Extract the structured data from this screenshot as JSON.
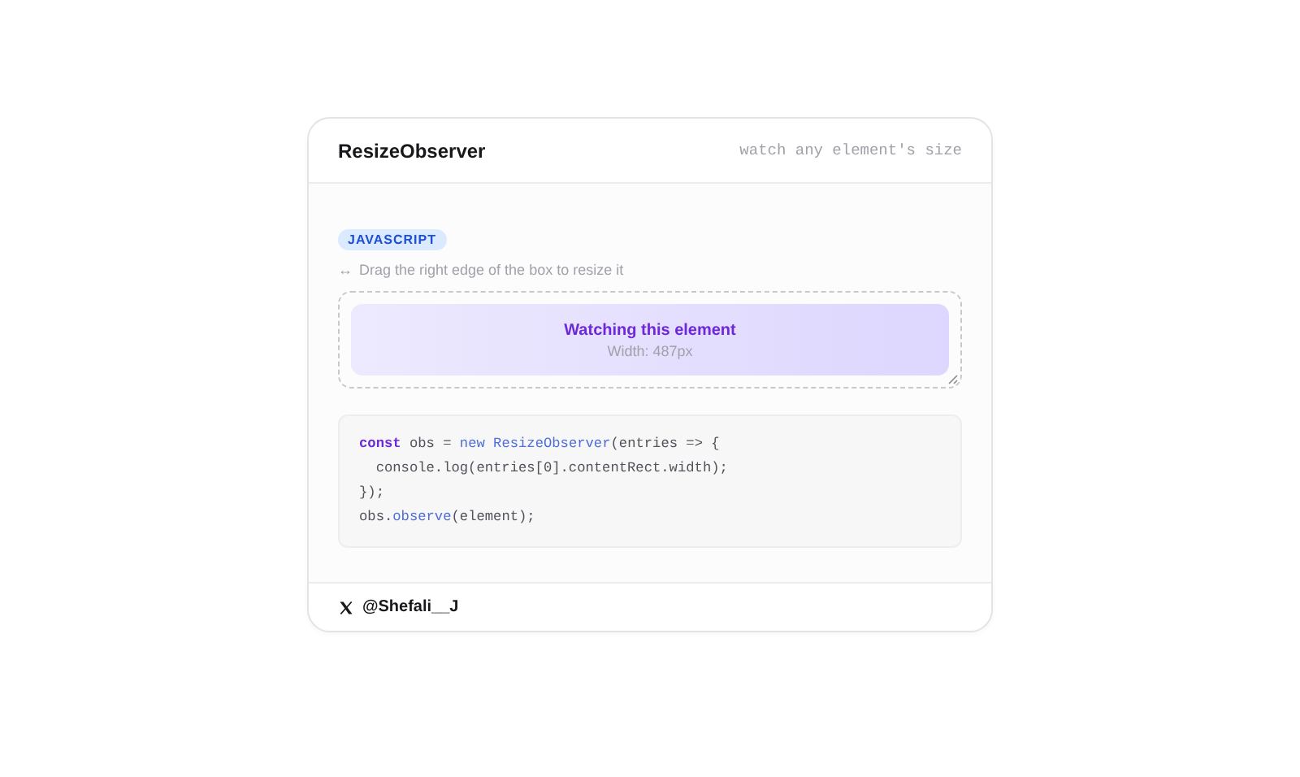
{
  "card": {
    "title": "ResizeObserver",
    "subtitle": "watch any element's size"
  },
  "badge": "JAVASCRIPT",
  "hint": {
    "icon": "↔",
    "text": "Drag the right edge of the box to resize it"
  },
  "demo": {
    "title": "Watching this element",
    "width_label": "Width: 487px"
  },
  "code": [
    [
      {
        "kind": "keyword",
        "text": "const"
      },
      {
        "kind": "plain",
        "text": " obs = "
      },
      {
        "kind": "new",
        "text": "new"
      },
      {
        "kind": "fn",
        "text": " ResizeObserver"
      },
      {
        "kind": "plain",
        "text": "(entries => {"
      }
    ],
    [
      {
        "kind": "plain",
        "text": "  console.log(entries[0].contentRect.width);"
      }
    ],
    [
      {
        "kind": "plain",
        "text": "});"
      }
    ],
    [
      {
        "kind": "plain",
        "text": "obs."
      },
      {
        "kind": "fn",
        "text": "observe"
      },
      {
        "kind": "plain",
        "text": "(element);"
      }
    ]
  ],
  "footer": {
    "handle": "@Shefali__J"
  }
}
